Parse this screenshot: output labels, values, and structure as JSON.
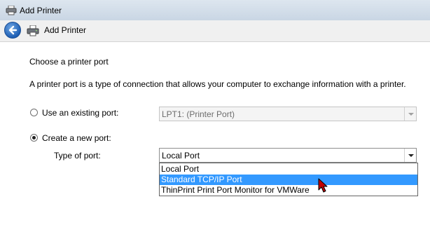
{
  "window": {
    "title": "Add Printer"
  },
  "command_bar": {
    "title": "Add Printer",
    "back_icon": "back-arrow-icon",
    "printer_icon": "printer-icon"
  },
  "page": {
    "heading": "Choose a printer port",
    "description": "A printer port is a type of connection that allows your computer to exchange information with a printer."
  },
  "existing_port": {
    "label": "Use an existing port:",
    "selected": false,
    "value": "LPT1: (Printer Port)",
    "enabled": false
  },
  "new_port": {
    "label": "Create a new port:",
    "selected": true,
    "type_label": "Type of port:",
    "type_value": "Local Port",
    "dropdown_open": true,
    "options": [
      "Local Port",
      "Standard TCP/IP Port",
      "ThinPrint Print Port Monitor for VMWare"
    ],
    "highlighted_index": 1
  },
  "colors": {
    "highlight": "#3399ff",
    "cursor": "#c00000"
  }
}
